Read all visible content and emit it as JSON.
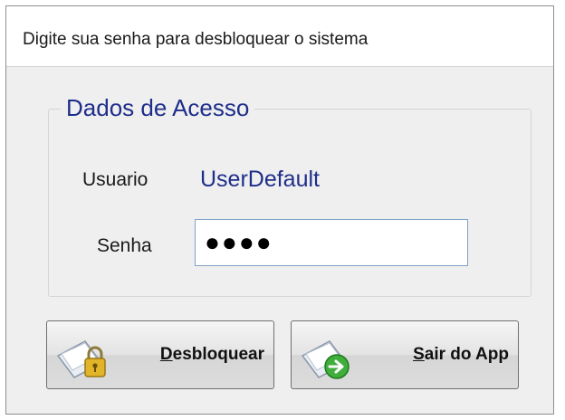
{
  "header": {
    "prompt": "Digite sua senha para desbloquear o sistema"
  },
  "group": {
    "title": "Dados de Acesso"
  },
  "fields": {
    "user_label": "Usuario",
    "user_value": "UserDefault",
    "password_label": "Senha",
    "password_value": "●●●●"
  },
  "buttons": {
    "unlock": {
      "accel": "D",
      "rest": "esbloquear",
      "icon": "padlock-icon"
    },
    "exit": {
      "accel": "S",
      "rest": "air do App",
      "icon": "exit-arrow-icon"
    }
  },
  "colors": {
    "accent": "#1f2e8a",
    "input_border": "#7fa3c6"
  }
}
